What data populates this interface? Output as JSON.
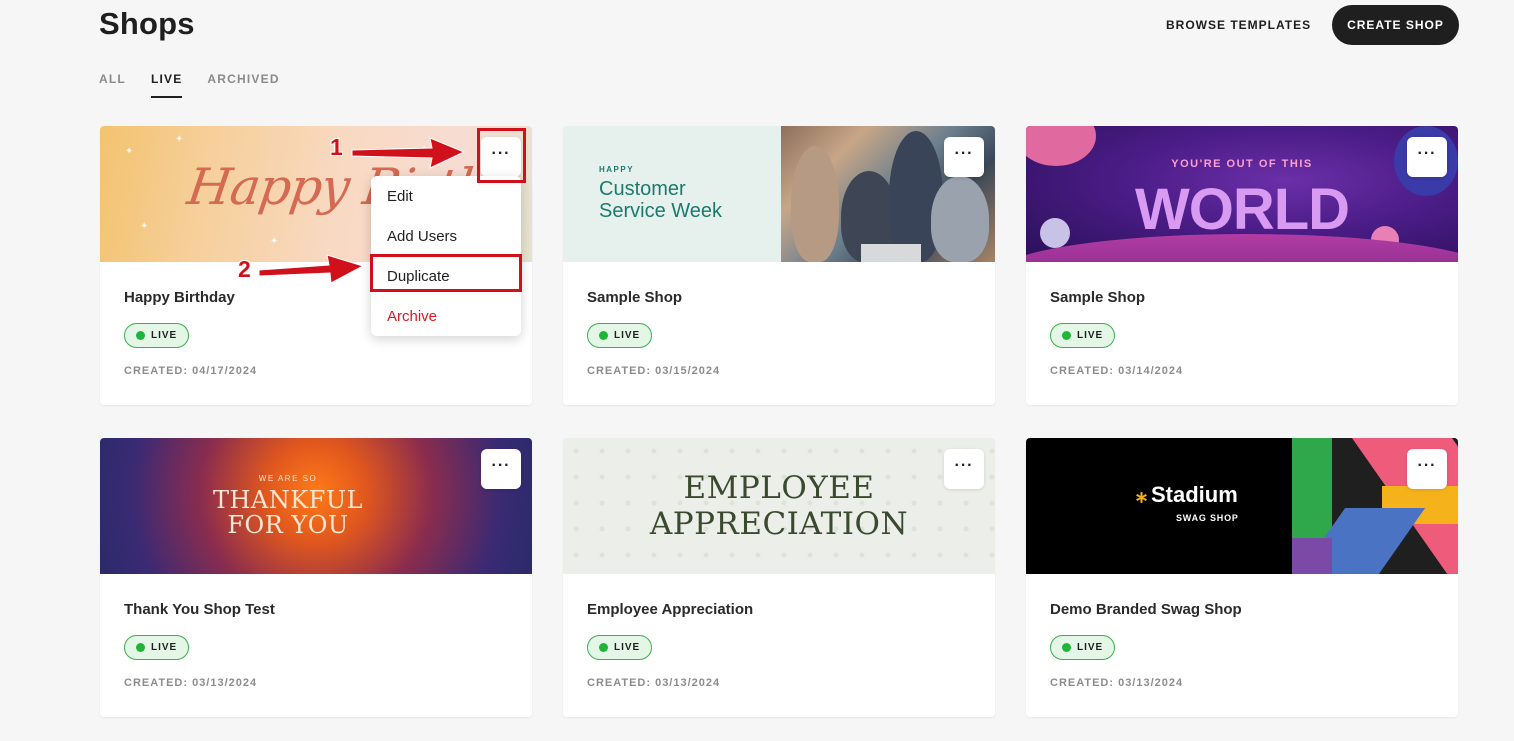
{
  "header": {
    "title": "Shops",
    "browse_label": "BROWSE TEMPLATES",
    "create_label": "CREATE SHOP"
  },
  "tabs": [
    {
      "label": "ALL"
    },
    {
      "label": "LIVE"
    },
    {
      "label": "ARCHIVED"
    }
  ],
  "active_tab": "LIVE",
  "cards": [
    {
      "title": "Happy Birthday",
      "status": "LIVE",
      "created": "CREATED: 04/17/2024",
      "banner_text": "Happy Birth"
    },
    {
      "title": "Sample Shop",
      "status": "LIVE",
      "created": "CREATED: 03/15/2024",
      "banner_small": "HAPPY",
      "banner_line1": "Customer",
      "banner_line2": "Service Week"
    },
    {
      "title": "Sample Shop",
      "status": "LIVE",
      "created": "CREATED: 03/14/2024",
      "banner_small": "YOU'RE OUT OF THIS",
      "banner_big": "WORLD"
    },
    {
      "title": "Thank You Shop Test",
      "status": "LIVE",
      "created": "CREATED: 03/13/2024",
      "banner_small": "WE ARE SO",
      "banner_line1": "THANKFUL",
      "banner_line2": "FOR YOU"
    },
    {
      "title": "Employee Appreciation",
      "status": "LIVE",
      "created": "CREATED: 03/13/2024",
      "banner_line1": "EMPLOYEE",
      "banner_line2": "APPRECIATION"
    },
    {
      "title": "Demo Branded Swag Shop",
      "status": "LIVE",
      "created": "CREATED: 03/13/2024",
      "banner_logo": "Stadium",
      "banner_sub": "SWAG SHOP"
    }
  ],
  "more_icon": "···",
  "menu": {
    "items": [
      {
        "label": "Edit"
      },
      {
        "label": "Add Users"
      },
      {
        "label": "Duplicate"
      },
      {
        "label": "Archive"
      }
    ]
  },
  "annotations": {
    "step1": "1",
    "step2": "2",
    "color": "#d0101a"
  },
  "colors": {
    "live_badge_bg": "#e4f6e6",
    "live_badge_border": "#3cae4f",
    "live_dot": "#1fb53a",
    "primary_button": "#1f1f1f",
    "danger": "#d21c1c"
  }
}
